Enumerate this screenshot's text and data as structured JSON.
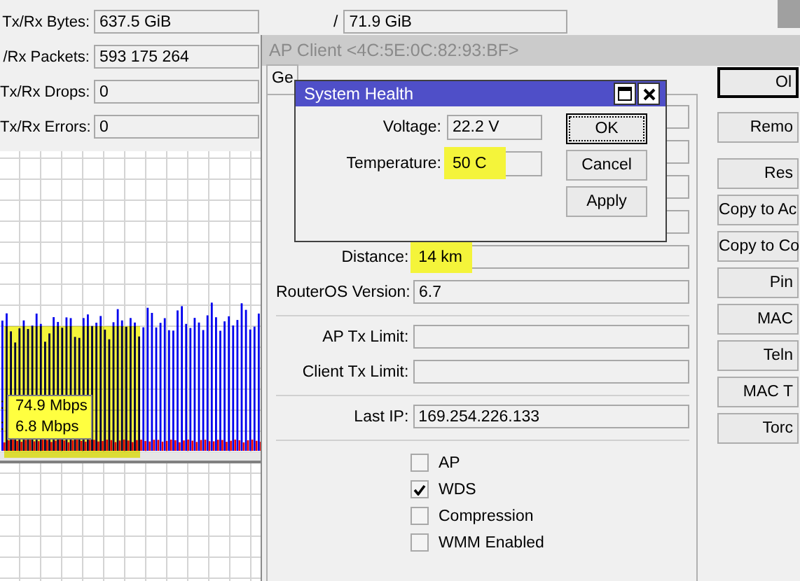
{
  "background_window": {
    "stats": [
      {
        "label": "Tx/Rx Bytes:",
        "value": "637.5 GiB",
        "separator": "/",
        "value_2": "71.9 GiB"
      },
      {
        "label": "/Rx Packets:",
        "value": "593 175 264"
      },
      {
        "label": "Tx/Rx Drops:",
        "value": "0"
      },
      {
        "label": "Tx/Rx Errors:",
        "value": "0"
      }
    ],
    "traffic_graph": {
      "highlighted": true,
      "tooltip": [
        {
          "label": ":",
          "value": "74.9 Mbps"
        },
        {
          "label": ":",
          "value": "6.8 Mbps"
        }
      ]
    }
  },
  "ap_client_window": {
    "title": "AP Client <4C:5E:0C:82:93:BF>",
    "active": false,
    "tabs": [
      {
        "label": "Ge",
        "selected": true
      }
    ],
    "rows": [
      {
        "kind": "field",
        "label": "Distance:",
        "value": "14 km",
        "highlighted": true
      },
      {
        "kind": "field",
        "label": "RouterOS Version:",
        "value": "6.7",
        "highlighted": false
      },
      {
        "kind": "separator"
      },
      {
        "kind": "field",
        "label": "AP Tx Limit:",
        "highlighted": false
      },
      {
        "kind": "field",
        "label": "Client Tx Limit:",
        "highlighted": false
      },
      {
        "kind": "separator"
      },
      {
        "kind": "field",
        "label": "Last IP:",
        "value": "169.254.226.133",
        "highlighted": false
      },
      {
        "kind": "separator"
      },
      {
        "kind": "checkbox",
        "label": "AP",
        "checked": false
      },
      {
        "kind": "checkbox",
        "label": "WDS",
        "checked": true
      },
      {
        "kind": "checkbox",
        "label": "Compression",
        "checked": false
      },
      {
        "kind": "checkbox",
        "label": "WMM Enabled",
        "checked": false
      }
    ],
    "buttons": [
      {
        "label": "Ol",
        "default": true
      },
      {
        "label": "Remo",
        "default": false
      },
      {
        "label": "Res",
        "default": false
      },
      {
        "label": "Copy to Ac",
        "default": false
      },
      {
        "label": "Copy to Co",
        "default": false
      },
      {
        "label": "Pin",
        "default": false
      },
      {
        "label": "MAC",
        "default": false
      },
      {
        "label": "Teln",
        "default": false
      },
      {
        "label": "MAC T",
        "default": false
      },
      {
        "label": "Torc",
        "default": false
      }
    ]
  },
  "system_health_dialog": {
    "title": "System Health",
    "active": true,
    "fields": [
      {
        "label": "Voltage:",
        "value": "22.2 V",
        "highlighted": false
      },
      {
        "label": "Temperature:",
        "value": "50 C",
        "highlighted": true
      }
    ],
    "buttons": [
      {
        "label": "OK",
        "focused": true
      },
      {
        "label": "Cancel",
        "focused": false
      },
      {
        "label": "Apply",
        "focused": false
      }
    ]
  }
}
